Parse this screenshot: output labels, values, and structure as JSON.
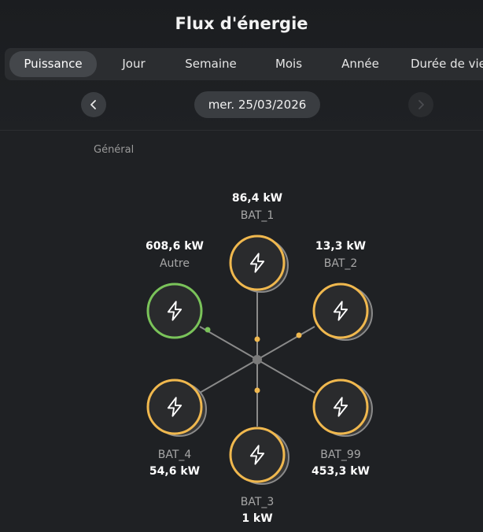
{
  "header": {
    "title": "Flux d'énergie"
  },
  "tabs": [
    {
      "label": "Puissance",
      "active": true
    },
    {
      "label": "Jour",
      "active": false
    },
    {
      "label": "Semaine",
      "active": false
    },
    {
      "label": "Mois",
      "active": false
    },
    {
      "label": "Année",
      "active": false
    },
    {
      "label": "Durée de vie",
      "active": false
    }
  ],
  "date_nav": {
    "date": "mer. 25/03/2026",
    "prev_icon": "chevron-left-icon",
    "next_icon": "chevron-right-icon",
    "next_enabled": false
  },
  "section": {
    "label": "Général"
  },
  "nodes": {
    "bat_1": {
      "name": "BAT_1",
      "value": "86,4  kW",
      "color": "#f0b84e",
      "icon": "lightning-icon"
    },
    "bat_2": {
      "name": "BAT_2",
      "value": "13,3  kW",
      "color": "#f0b84e",
      "icon": "lightning-icon"
    },
    "autre": {
      "name": "Autre",
      "value": "608,6  kW",
      "color": "#7ac35a",
      "icon": "lightning-icon"
    },
    "bat_4": {
      "name": "BAT_4",
      "value": "54,6  kW",
      "color": "#f0b84e",
      "icon": "lightning-icon"
    },
    "bat_99": {
      "name": "BAT_99",
      "value": "453,3  kW",
      "color": "#f0b84e",
      "icon": "lightning-icon"
    },
    "bat_3": {
      "name": "BAT_3",
      "value": "1  kW",
      "color": "#f0b84e",
      "icon": "lightning-icon"
    }
  },
  "colors": {
    "background": "#1f2124",
    "line": "#8a8a8a",
    "hub": "#7a7a7a",
    "battery_ring": "#f0b84e",
    "other_ring": "#7ac35a"
  }
}
